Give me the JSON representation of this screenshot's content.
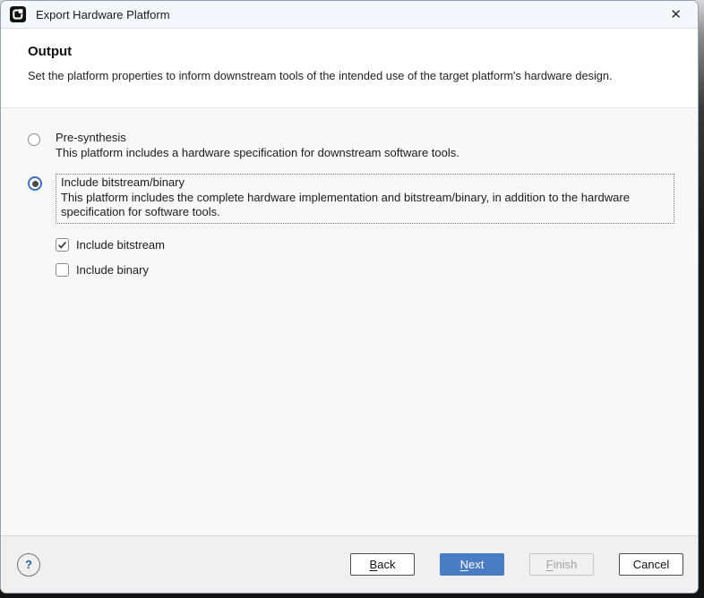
{
  "window": {
    "title": "Export Hardware Platform",
    "close_glyph": "✕"
  },
  "header": {
    "title": "Output",
    "description": "Set the platform properties to inform downstream tools of the intended use of the target platform's hardware design."
  },
  "options": [
    {
      "label": "Pre-synthesis",
      "description": "This platform includes a hardware specification for downstream software tools.",
      "selected": false
    },
    {
      "label": "Include bitstream/binary",
      "description": "This platform includes the complete hardware implementation and bitstream/binary, in addition to the hardware specification for software tools.",
      "selected": true
    }
  ],
  "sub_options": [
    {
      "label": "Include bitstream",
      "checked": true
    },
    {
      "label": "Include binary",
      "checked": false
    }
  ],
  "footer": {
    "help_glyph": "?",
    "buttons": [
      {
        "name": "back",
        "mnemonic": "B",
        "rest": "ack",
        "style": "secondary",
        "enabled": true
      },
      {
        "name": "next",
        "mnemonic": "N",
        "rest": "ext",
        "style": "primary",
        "enabled": true
      },
      {
        "name": "finish",
        "mnemonic": "F",
        "rest": "inish",
        "style": "secondary",
        "enabled": false
      },
      {
        "name": "cancel",
        "mnemonic": "",
        "rest": "Cancel",
        "style": "secondary",
        "enabled": true
      }
    ]
  },
  "colors": {
    "primary_button": "#4a7cc4",
    "radio_selected_ring": "#3a6fbf",
    "titlebar_bg": "#f4f8fc",
    "content_bg": "#f8f8f8",
    "footer_bg": "#f0f0f0"
  }
}
